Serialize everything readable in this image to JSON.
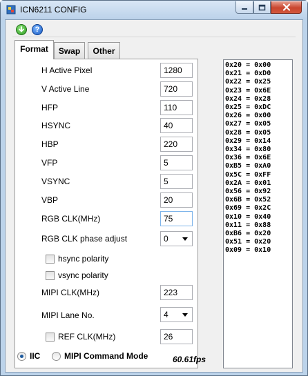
{
  "window": {
    "title": "ICN6211 CONFIG",
    "controls": {
      "minimize": "—",
      "maximize": "□",
      "close": "✕"
    }
  },
  "toolbar": {
    "run_icon": "green-arrow-down-icon",
    "help_icon": "help-icon",
    "help_glyph": "?"
  },
  "tabs": [
    {
      "label": "Format",
      "active": true
    },
    {
      "label": "Swap",
      "active": false
    },
    {
      "label": "Other",
      "active": false
    }
  ],
  "format": {
    "h_active_pixel": {
      "label": "H Active Pixel",
      "value": "1280"
    },
    "v_active_line": {
      "label": "V Active Line",
      "value": "720"
    },
    "hfp": {
      "label": "HFP",
      "value": "110"
    },
    "hsync": {
      "label": "HSYNC",
      "value": "40"
    },
    "hbp": {
      "label": "HBP",
      "value": "220"
    },
    "vfp": {
      "label": "VFP",
      "value": "5"
    },
    "vsync": {
      "label": "VSYNC",
      "value": "5"
    },
    "vbp": {
      "label": "VBP",
      "value": "20"
    },
    "rgb_clk": {
      "label": "RGB CLK(MHz)",
      "value": "75"
    },
    "rgb_clk_phase": {
      "label": "RGB CLK phase adjust",
      "value": "0"
    },
    "hsync_polarity": {
      "label": "hsync polarity",
      "checked": false
    },
    "vsync_polarity": {
      "label": "vsync polarity",
      "checked": false
    },
    "mipi_clk": {
      "label": "MIPI CLK(MHz)",
      "value": "223"
    },
    "mipi_lane": {
      "label": "MIPI Lane No.",
      "value": "4"
    },
    "ref_clk": {
      "label": "REF CLK(MHz)",
      "value": "26",
      "checked": false
    }
  },
  "mode": {
    "iic_label": "IIC",
    "mipi_label": "MIPI Command Mode",
    "selected": "IIC"
  },
  "fps": "60.61fps",
  "registers": [
    "0x20 = 0x00",
    "0x21 = 0xD0",
    "0x22 = 0x25",
    "0x23 = 0x6E",
    "0x24 = 0x28",
    "0x25 = 0xDC",
    "0x26 = 0x00",
    "0x27 = 0x05",
    "0x28 = 0x05",
    "0x29 = 0x14",
    "0x34 = 0x80",
    "0x36 = 0x6E",
    "0xB5 = 0xA0",
    "0x5C = 0xFF",
    "0x2A = 0x01",
    "0x56 = 0x92",
    "0x6B = 0x52",
    "0x69 = 0x2C",
    "0x10 = 0x40",
    "0x11 = 0x88",
    "0xB6 = 0x20",
    "0x51 = 0x20",
    "0x09 = 0x10"
  ]
}
